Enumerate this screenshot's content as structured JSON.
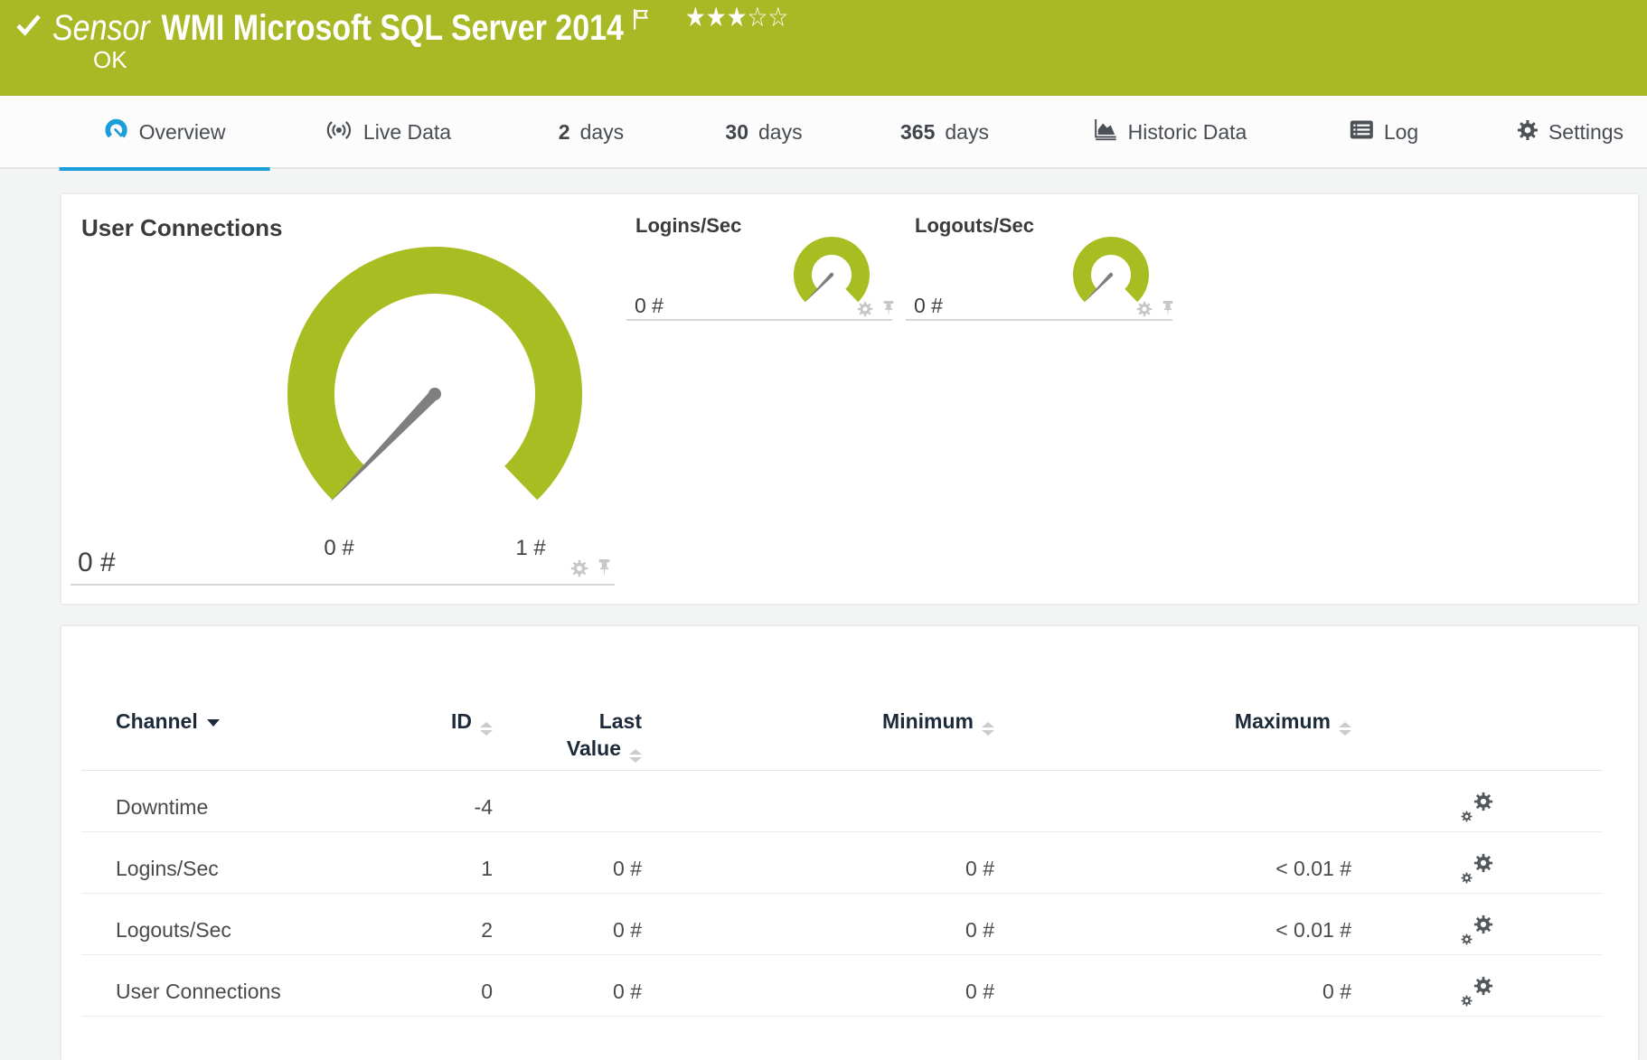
{
  "header": {
    "kind": "Sensor",
    "title": "WMI Microsoft SQL Server 2014",
    "status": "OK",
    "rating_stars": "★★★☆☆"
  },
  "tabs": {
    "overview": "Overview",
    "live_data": "Live Data",
    "d2_num": "2",
    "d2_unit": "days",
    "d30_num": "30",
    "d30_unit": "days",
    "d365_num": "365",
    "d365_unit": "days",
    "historic": "Historic Data",
    "log": "Log",
    "settings": "Settings"
  },
  "gauges": {
    "main": {
      "title": "User Connections",
      "value": "0 #",
      "min": "0 #",
      "max": "1 #"
    },
    "logins": {
      "title": "Logins/Sec",
      "value": "0 #"
    },
    "logouts": {
      "title": "Logouts/Sec",
      "value": "0 #"
    }
  },
  "table": {
    "headers": {
      "channel": "Channel",
      "id": "ID",
      "last_line1": "Last",
      "last_line2": "Value",
      "min": "Minimum",
      "max": "Maximum"
    },
    "rows": [
      {
        "channel": "Downtime",
        "id": "-4",
        "last": "",
        "min": "",
        "max": ""
      },
      {
        "channel": "Logins/Sec",
        "id": "1",
        "last": "0 #",
        "min": "0 #",
        "max": "< 0.01 #"
      },
      {
        "channel": "Logouts/Sec",
        "id": "2",
        "last": "0 #",
        "min": "0 #",
        "max": "< 0.01 #"
      },
      {
        "channel": "User Connections",
        "id": "0",
        "last": "0 #",
        "min": "0 #",
        "max": "0 #"
      }
    ]
  },
  "colors": {
    "brand_green": "#a9b925",
    "accent_blue": "#1a9ed9",
    "gauge_green": "#a8bd22"
  }
}
